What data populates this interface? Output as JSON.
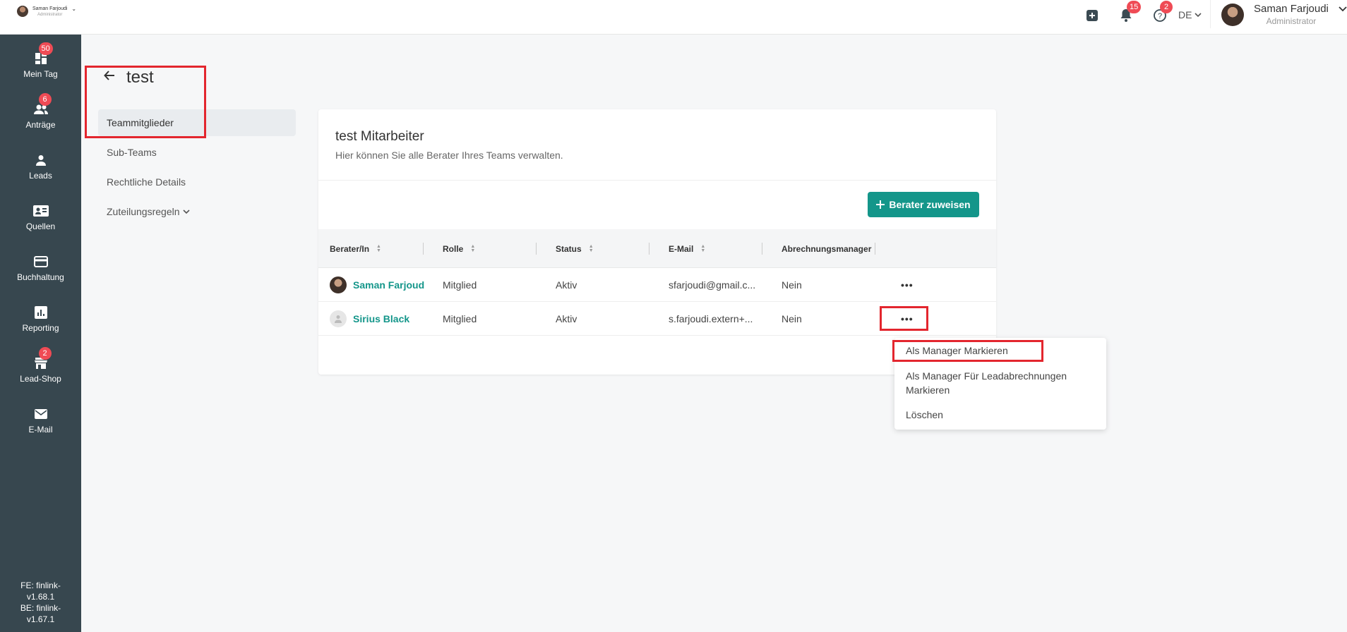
{
  "header": {
    "brand_name": "Saman Farjoudi",
    "brand_role": "Administrator",
    "notifications_count": "15",
    "help_count": "2",
    "language": "DE",
    "user_name": "Saman Farjoudi",
    "user_role": "Administrator"
  },
  "sidebar": {
    "items": [
      {
        "label": "Mein Tag",
        "icon": "dashboard-icon",
        "badge": "50"
      },
      {
        "label": "Anträge",
        "icon": "users-icon",
        "badge": "6"
      },
      {
        "label": "Leads",
        "icon": "person-icon",
        "badge": ""
      },
      {
        "label": "Quellen",
        "icon": "contact-card-icon",
        "badge": ""
      },
      {
        "label": "Buchhaltung",
        "icon": "credit-card-icon",
        "badge": ""
      },
      {
        "label": "Reporting",
        "icon": "chart-icon",
        "badge": ""
      },
      {
        "label": "Lead-Shop",
        "icon": "store-icon",
        "badge": "2"
      },
      {
        "label": "E-Mail",
        "icon": "mail-icon",
        "badge": ""
      }
    ],
    "version_fe_label": "FE: finlink-",
    "version_fe": "v1.68.1",
    "version_be_label": "BE: finlink-",
    "version_be": "v1.67.1"
  },
  "team": {
    "title": "test",
    "subnav": [
      {
        "label": "Teammitglieder",
        "active": true
      },
      {
        "label": "Sub-Teams"
      },
      {
        "label": "Rechtliche Details"
      },
      {
        "label": "Zuteilungsregeln"
      }
    ]
  },
  "card": {
    "title": "test Mitarbeiter",
    "subtitle": "Hier können Sie alle Berater Ihres Teams verwalten.",
    "add_button": "Berater zuweisen"
  },
  "table": {
    "columns": [
      "Berater/In",
      "Rolle",
      "Status",
      "E-Mail",
      "Abrechnungsmanager"
    ],
    "rows": [
      {
        "name": "Saman Farjoudi",
        "role": "Mitglied",
        "status": "Aktiv",
        "email": "sfarjoudi@gmail.c...",
        "manager": "Nein",
        "more": "•••"
      },
      {
        "name": "Sirius Black",
        "role": "Mitglied",
        "status": "Aktiv",
        "email": "s.farjoudi.extern+...",
        "manager": "Nein",
        "more": "•••"
      }
    ]
  },
  "menu": {
    "items": [
      "Als Manager Markieren",
      "Als Manager Für Leadabrechnungen Markieren",
      "Löschen"
    ]
  },
  "colors": {
    "sidebar": "#37474f",
    "accent": "#14968a",
    "badge": "#ef4b55",
    "highlight": "#e3262e"
  }
}
